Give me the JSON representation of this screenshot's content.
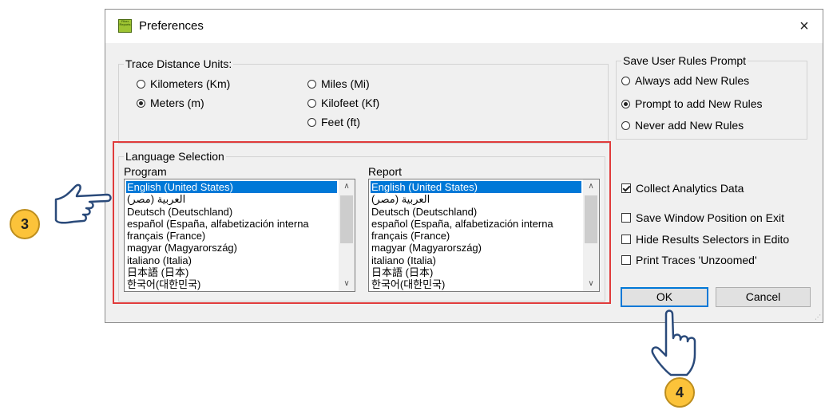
{
  "window": {
    "title": "Preferences",
    "icon_text": "Fiber Reports",
    "close_glyph": "×"
  },
  "trace_units": {
    "legend": "Trace Distance Units:",
    "options": [
      {
        "label": "Kilometers (Km)",
        "checked": false
      },
      {
        "label": "Meters (m)",
        "checked": true
      },
      {
        "label": "Miles (Mi)",
        "checked": false
      },
      {
        "label": "Kilofeet (Kf)",
        "checked": false
      },
      {
        "label": "Feet (ft)",
        "checked": false
      }
    ]
  },
  "save_rules": {
    "legend": "Save User Rules Prompt",
    "options": [
      {
        "label": "Always add New Rules",
        "checked": false
      },
      {
        "label": "Prompt to add New Rules",
        "checked": true
      },
      {
        "label": "Never add New Rules",
        "checked": false
      }
    ]
  },
  "language": {
    "legend": "Language Selection",
    "program_label": "Program",
    "report_label": "Report",
    "items": [
      "English (United States)",
      "(العربية (مصر",
      "Deutsch (Deutschland)",
      "español (España, alfabetización interna",
      "français (France)",
      "magyar (Magyarország)",
      "italiano (Italia)",
      "日本語 (日本)",
      "한국어(대한민국)"
    ],
    "selected_index": 0,
    "scroll_up_glyph": "∧",
    "scroll_down_glyph": "∨"
  },
  "options": {
    "collect_analytics": {
      "label": "Collect Analytics Data",
      "checked": true
    },
    "save_window_position": {
      "label": "Save Window Position on Exit",
      "checked": false
    },
    "hide_results_selectors": {
      "label": "Hide Results Selectors in Edito",
      "checked": false
    },
    "print_traces": {
      "label": "Print Traces 'Unzoomed'",
      "checked": false
    }
  },
  "buttons": {
    "ok": "OK",
    "cancel": "Cancel"
  },
  "callouts": {
    "step3": "3",
    "step4": "4"
  },
  "colors": {
    "highlight": "#e03b3b",
    "callout_fill": "#fcc33a",
    "selection": "#0078d7"
  }
}
